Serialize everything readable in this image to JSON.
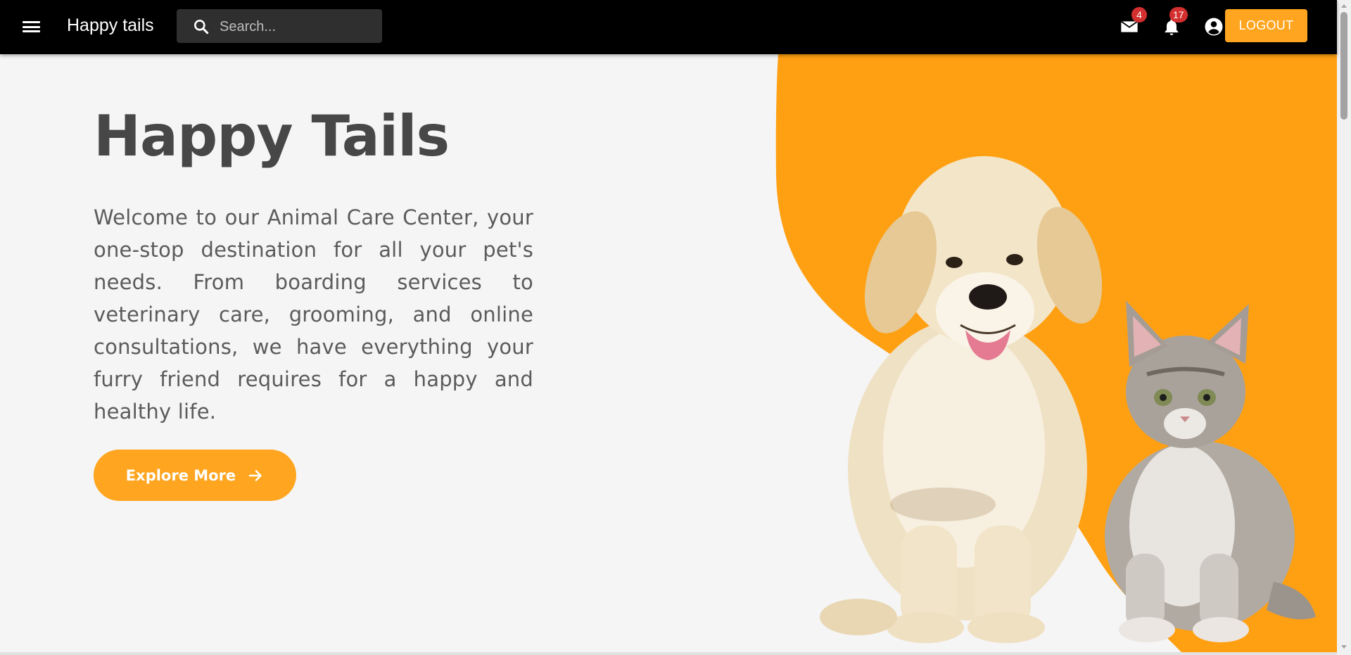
{
  "appbar": {
    "brand": "Happy tails",
    "search_placeholder": "Search...",
    "mail_count": "4",
    "notification_count": "17",
    "logout_label": "LOGOUT"
  },
  "hero": {
    "title": "Happy Tails",
    "intro": "Welcome to our Animal Care Center, your one-stop destination for all your pet's needs. From boarding services to veterinary care, grooming, and online consultations, we have everything your furry friend requires for a happy and healthy life.",
    "cta_label": "Explore More",
    "image_subject": "golden retriever puppy and tabby kitten"
  },
  "colors": {
    "accent": "#ffa51f",
    "appbar_bg": "#000000",
    "badge": "#d32f2f",
    "page_bg": "#f5f5f5",
    "heading": "#474747",
    "body_text": "#5b5b5b"
  },
  "icons": [
    "menu-icon",
    "search-icon",
    "mail-icon",
    "bell-icon",
    "account-circle-icon",
    "arrow-right-icon"
  ]
}
